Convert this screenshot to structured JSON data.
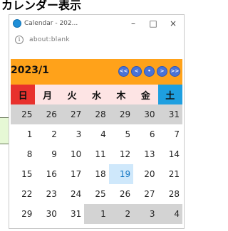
{
  "header_text": "カレンダー表示",
  "window": {
    "title": "Calendar - 202...",
    "url": "about:blank",
    "controls": [
      "–",
      "□",
      "×"
    ]
  },
  "calendar": {
    "year_month": "2023/1",
    "nav_buttons": [
      "<<",
      "<",
      "•",
      ">",
      ">>"
    ],
    "weekdays": [
      "日",
      "月",
      "火",
      "水",
      "木",
      "金",
      "土"
    ],
    "weeks": [
      [
        {
          "day": "25",
          "type": "other"
        },
        {
          "day": "26",
          "type": "other"
        },
        {
          "day": "27",
          "type": "other"
        },
        {
          "day": "28",
          "type": "other"
        },
        {
          "day": "29",
          "type": "other"
        },
        {
          "day": "30",
          "type": "other"
        },
        {
          "day": "31",
          "type": "other"
        }
      ],
      [
        {
          "day": "1",
          "type": "cur"
        },
        {
          "day": "2",
          "type": "cur"
        },
        {
          "day": "3",
          "type": "cur"
        },
        {
          "day": "4",
          "type": "cur"
        },
        {
          "day": "5",
          "type": "cur"
        },
        {
          "day": "6",
          "type": "cur"
        },
        {
          "day": "7",
          "type": "cur"
        }
      ],
      [
        {
          "day": "8",
          "type": "cur"
        },
        {
          "day": "9",
          "type": "cur"
        },
        {
          "day": "10",
          "type": "cur"
        },
        {
          "day": "11",
          "type": "cur"
        },
        {
          "day": "12",
          "type": "cur"
        },
        {
          "day": "13",
          "type": "cur"
        },
        {
          "day": "14",
          "type": "cur"
        }
      ],
      [
        {
          "day": "15",
          "type": "cur"
        },
        {
          "day": "16",
          "type": "cur"
        },
        {
          "day": "17",
          "type": "cur"
        },
        {
          "day": "18",
          "type": "cur"
        },
        {
          "day": "19",
          "type": "today"
        },
        {
          "day": "20",
          "type": "cur"
        },
        {
          "day": "21",
          "type": "cur"
        }
      ],
      [
        {
          "day": "22",
          "type": "cur"
        },
        {
          "day": "23",
          "type": "cur"
        },
        {
          "day": "24",
          "type": "cur"
        },
        {
          "day": "25",
          "type": "cur"
        },
        {
          "day": "26",
          "type": "cur"
        },
        {
          "day": "27",
          "type": "cur"
        },
        {
          "day": "28",
          "type": "cur"
        }
      ],
      [
        {
          "day": "29",
          "type": "cur"
        },
        {
          "day": "30",
          "type": "cur"
        },
        {
          "day": "31",
          "type": "cur"
        },
        {
          "day": "1",
          "type": "other"
        },
        {
          "day": "2",
          "type": "other"
        },
        {
          "day": "3",
          "type": "other"
        },
        {
          "day": "4",
          "type": "other"
        }
      ]
    ]
  }
}
